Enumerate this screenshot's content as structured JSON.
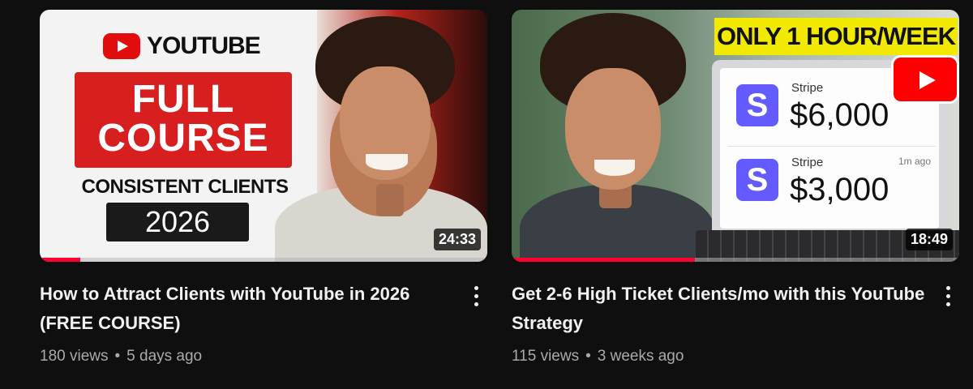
{
  "videos": [
    {
      "thumbnail": {
        "logo_text": "YOUTUBE",
        "headline_line1": "FULL",
        "headline_line2": "COURSE",
        "subtext": "CONSISTENT CLIENTS",
        "year": "2026"
      },
      "duration": "24:33",
      "watch_progress": 0.09,
      "title": "How to Attract Clients with YouTube in 2026 (FREE COURSE)",
      "views": "180 views",
      "separator": "•",
      "age": "5 days ago"
    },
    {
      "thumbnail": {
        "banner": "ONLY 1 HOUR/WEEK",
        "payments": [
          {
            "brand": "Stripe",
            "logo_letter": "S",
            "amount": "$6,000",
            "time": ""
          },
          {
            "brand": "Stripe",
            "logo_letter": "S",
            "amount": "$3,000",
            "time": "1m ago"
          }
        ]
      },
      "duration": "18:49",
      "watch_progress": 0.41,
      "title": "Get 2-6 High Ticket Clients/mo with this YouTube Strategy",
      "views": "115 views",
      "separator": "•",
      "age": "3 weeks ago"
    }
  ],
  "colors": {
    "background": "#0f0f0f",
    "progress": "#ff0033",
    "title": "#f1f1f1",
    "meta": "#aaaaaa"
  },
  "icons": [
    "youtube-logo-icon",
    "more-vert-icon",
    "stripe-logo-icon",
    "play-badge-icon"
  ]
}
